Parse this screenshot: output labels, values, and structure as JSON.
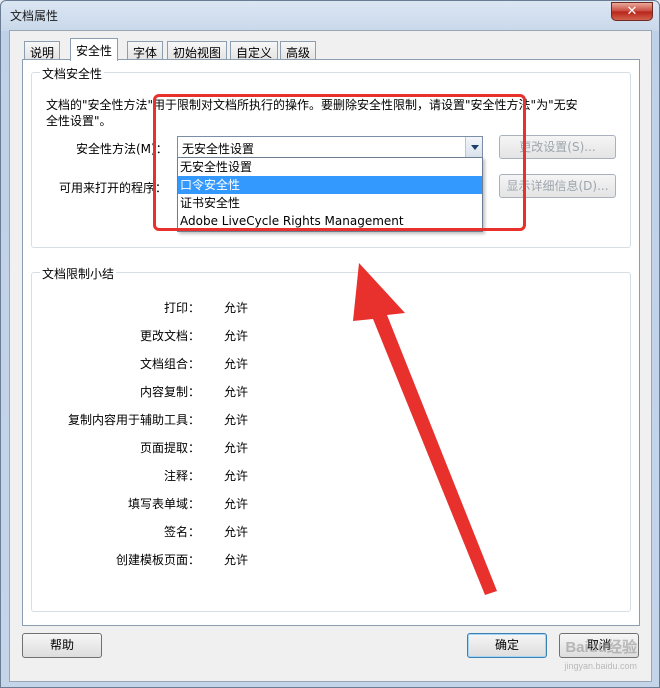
{
  "window": {
    "title": "文档属性",
    "close_label": "✕"
  },
  "tabs": [
    {
      "label": "说明",
      "active": false
    },
    {
      "label": "安全性",
      "active": true
    },
    {
      "label": "字体",
      "active": false
    },
    {
      "label": "初始视图",
      "active": false
    },
    {
      "label": "自定义",
      "active": false
    },
    {
      "label": "高级",
      "active": false
    }
  ],
  "security": {
    "group_title": "文档安全性",
    "description": "文档的\"安全性方法\"用于限制对文档所执行的操作。要删除安全性限制，请设置\"安全性方法\"为\"无安全性设置\"。",
    "method_label": "安全性方法(M)：",
    "method_value": "无安全性设置",
    "open_with_label": "可用来打开的程序：",
    "change_settings_button": "更改设置(S)...",
    "show_details_button": "显示详细信息(D)...",
    "dropdown_options": [
      {
        "label": "无安全性设置",
        "selected": false
      },
      {
        "label": "口令安全性",
        "selected": true
      },
      {
        "label": "证书安全性",
        "selected": false
      },
      {
        "label": "Adobe LiveCycle Rights Management",
        "selected": false
      }
    ]
  },
  "restrictions": {
    "group_title": "文档限制小结",
    "rows": [
      {
        "label": "打印：",
        "value": "允许"
      },
      {
        "label": "更改文档：",
        "value": "允许"
      },
      {
        "label": "文档组合：",
        "value": "允许"
      },
      {
        "label": "内容复制：",
        "value": "允许"
      },
      {
        "label": "复制内容用于辅助工具：",
        "value": "允许"
      },
      {
        "label": "页面提取：",
        "value": "允许"
      },
      {
        "label": "注释：",
        "value": "允许"
      },
      {
        "label": "填写表单域：",
        "value": "允许"
      },
      {
        "label": "签名：",
        "value": "允许"
      },
      {
        "label": "创建模板页面：",
        "value": "允许"
      }
    ]
  },
  "footer": {
    "help_button": "帮助",
    "ok_button": "确定",
    "cancel_button": "取消"
  },
  "watermark": {
    "text": "Baidu经验",
    "sub": "jingyan.baidu.com"
  },
  "colors": {
    "annotation": "#e8302c",
    "selection": "#3399ff"
  }
}
